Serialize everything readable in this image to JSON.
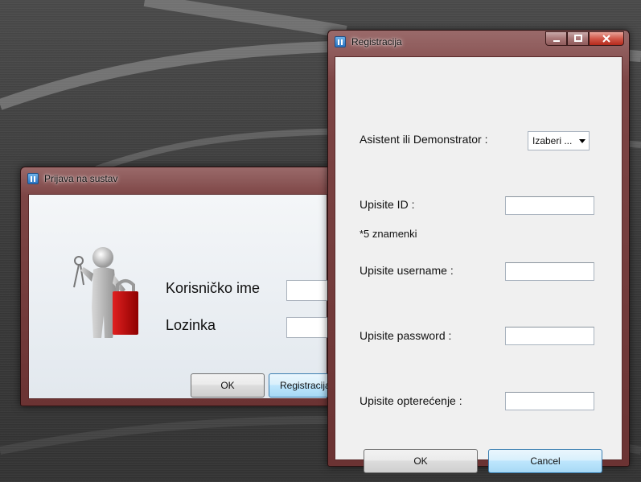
{
  "login_window": {
    "title": "Prijava na sustav",
    "username_label": "Korisničko ime",
    "password_label": "Lozinka",
    "ok_label": "OK",
    "register_label": "Registracija"
  },
  "registration_window": {
    "title": "Registracija",
    "role_label": "Asistent ili Demonstrator :",
    "role_select_value": "Izaberi ...",
    "id_label": "Upisite ID :",
    "id_hint": "*5 znamenki",
    "username_label": "Upisite username :",
    "password_label": "Upisite password :",
    "load_label": "Upisite opterećenje :",
    "ok_label": "OK",
    "cancel_label": "Cancel",
    "window_controls": {
      "minimize_icon": "minimize-icon",
      "maximize_icon": "maximize-icon",
      "close_icon": "close-icon"
    }
  }
}
